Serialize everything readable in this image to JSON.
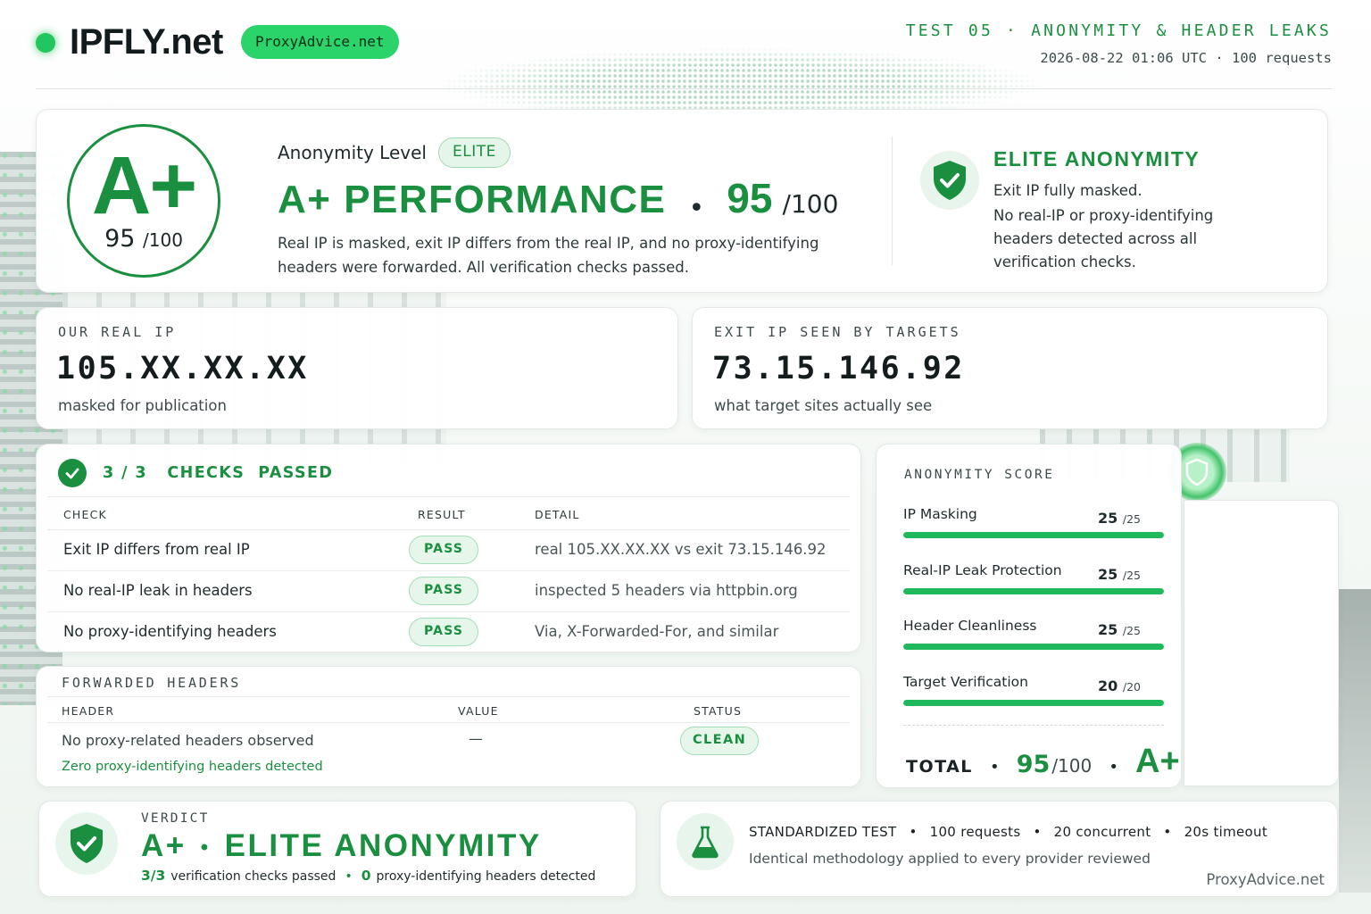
{
  "header": {
    "brand": "IPFLY.net",
    "pill": "ProxyAdvice.net",
    "test_title": "TEST 05 · ANONYMITY & HEADER LEAKS",
    "test_meta": "2026-08-22 01:06 UTC · 100 requests"
  },
  "summary": {
    "grade": "A+",
    "score": "95",
    "score_denom": "/100",
    "anon_label": "Anonymity Level",
    "level_badge": "ELITE",
    "performance_title": "A+ PERFORMANCE",
    "performance_score": "95",
    "performance_denom": "/100",
    "description": "Real IP is masked, exit IP differs from the real IP, and no proxy-identifying headers were forwarded. All verification checks passed.",
    "side_title": "ELITE ANONYMITY",
    "side_lines": [
      "Exit IP fully masked.",
      "No real-IP or proxy-identifying headers detected across all verification checks."
    ]
  },
  "real_ip": {
    "label": "OUR REAL IP",
    "value": "105.XX.XX.XX",
    "sub": "masked for publication"
  },
  "exit_ip": {
    "label": "EXIT IP SEEN BY TARGETS",
    "value": "73.15.146.92",
    "sub": "what target sites actually see"
  },
  "checks": {
    "title": "3 / 3   CHECKS  PASSED",
    "columns": [
      "CHECK",
      "RESULT",
      "DETAIL"
    ],
    "rows": [
      {
        "check": "Exit IP differs from real IP",
        "result": "PASS",
        "detail": "real 105.XX.XX.XX vs exit 73.15.146.92"
      },
      {
        "check": "No real-IP leak in headers",
        "result": "PASS",
        "detail": "inspected 5 headers via httpbin.org"
      },
      {
        "check": "No proxy-identifying headers",
        "result": "PASS",
        "detail": "Via, X-Forwarded-For, and similar"
      }
    ]
  },
  "forwarded": {
    "title": "FORWARDED HEADERS",
    "columns": [
      "HEADER",
      "VALUE",
      "STATUS"
    ],
    "row": {
      "header": "No proxy-related headers observed",
      "value": "—",
      "status": "CLEAN"
    },
    "note": "Zero proxy-identifying headers detected"
  },
  "score": {
    "title": "ANONYMITY SCORE",
    "items": [
      {
        "name": "IP Masking",
        "value": "25",
        "max": "/25",
        "fraction": 1.0
      },
      {
        "name": "Real-IP Leak Protection",
        "value": "25",
        "max": "/25",
        "fraction": 1.0
      },
      {
        "name": "Header Cleanliness",
        "value": "25",
        "max": "/25",
        "fraction": 1.0
      },
      {
        "name": "Target Verification",
        "value": "20",
        "max": "/20",
        "fraction": 1.0
      }
    ],
    "total_label": "TOTAL",
    "total_value": "95",
    "total_denom": "/100",
    "total_grade": "A+"
  },
  "verdict": {
    "label": "VERDICT",
    "grade": "A+",
    "title": "ELITE ANONYMITY",
    "checks_num": "3/3",
    "checks_text": "verification checks passed",
    "headers_num": "0",
    "headers_text": "proxy-identifying headers detected"
  },
  "method": {
    "items": [
      "STANDARDIZED TEST",
      "100 requests",
      "20 concurrent",
      "20s timeout"
    ],
    "sub": "Identical methodology applied to every provider reviewed",
    "brand": "ProxyAdvice.net"
  },
  "colors": {
    "accent": "#1a8f3f",
    "bright": "#22c55e",
    "pill_bg": "#e6f6eb"
  },
  "icons": [
    "shield-check-icon",
    "check-circle-icon",
    "flask-icon",
    "status-dot-icon"
  ]
}
